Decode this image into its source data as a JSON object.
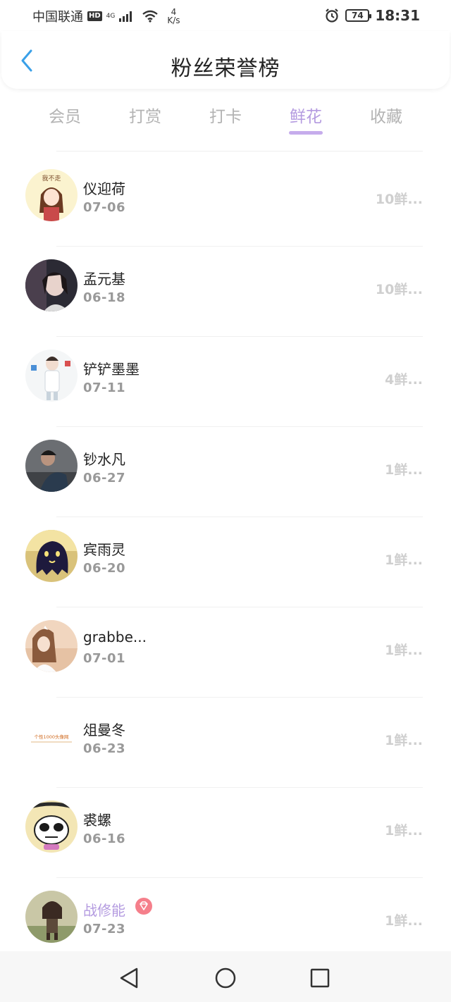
{
  "status_bar": {
    "carrier": "中国联通",
    "hd": "HD",
    "network_type": "4G",
    "speed_value": "4",
    "speed_unit": "K/s",
    "battery": "74",
    "time": "18:31"
  },
  "header": {
    "title": "粉丝荣誉榜",
    "back_icon": "chevron-left-icon"
  },
  "tabs": [
    {
      "label": "会员",
      "active": false
    },
    {
      "label": "打赏",
      "active": false
    },
    {
      "label": "打卡",
      "active": false
    },
    {
      "label": "鲜花",
      "active": true
    },
    {
      "label": "收藏",
      "active": false
    }
  ],
  "colors": {
    "accent": "#b49be0",
    "accent_underline": "#c6acec",
    "inactive_tab": "#b3b3b3",
    "vip_badge": "#f57f8b"
  },
  "fans": [
    {
      "name": "仪迎荷",
      "date": "07-06",
      "count": "10鲜..."
    },
    {
      "name": "孟元基",
      "date": "06-18",
      "count": "10鲜..."
    },
    {
      "name": "铲铲墨墨",
      "date": "07-11",
      "count": "4鲜..."
    },
    {
      "name": "钞水凡",
      "date": "06-27",
      "count": "1鲜..."
    },
    {
      "name": "宾雨灵",
      "date": "06-20",
      "count": "1鲜..."
    },
    {
      "name": "grabbe...",
      "date": "07-01",
      "count": "1鲜..."
    },
    {
      "name": "俎曼冬",
      "date": "06-23",
      "count": "1鲜..."
    },
    {
      "name": "裘螺",
      "date": "06-16",
      "count": "1鲜..."
    },
    {
      "name": "战修能",
      "date": "07-23",
      "count": "1鲜...",
      "vip": true
    }
  ],
  "avatar_text": {
    "a1": "我不走",
    "a7": "个性1000头像网"
  },
  "nav": {
    "back_icon": "triangle-back-icon",
    "home_icon": "circle-home-icon",
    "recents_icon": "square-recents-icon"
  }
}
